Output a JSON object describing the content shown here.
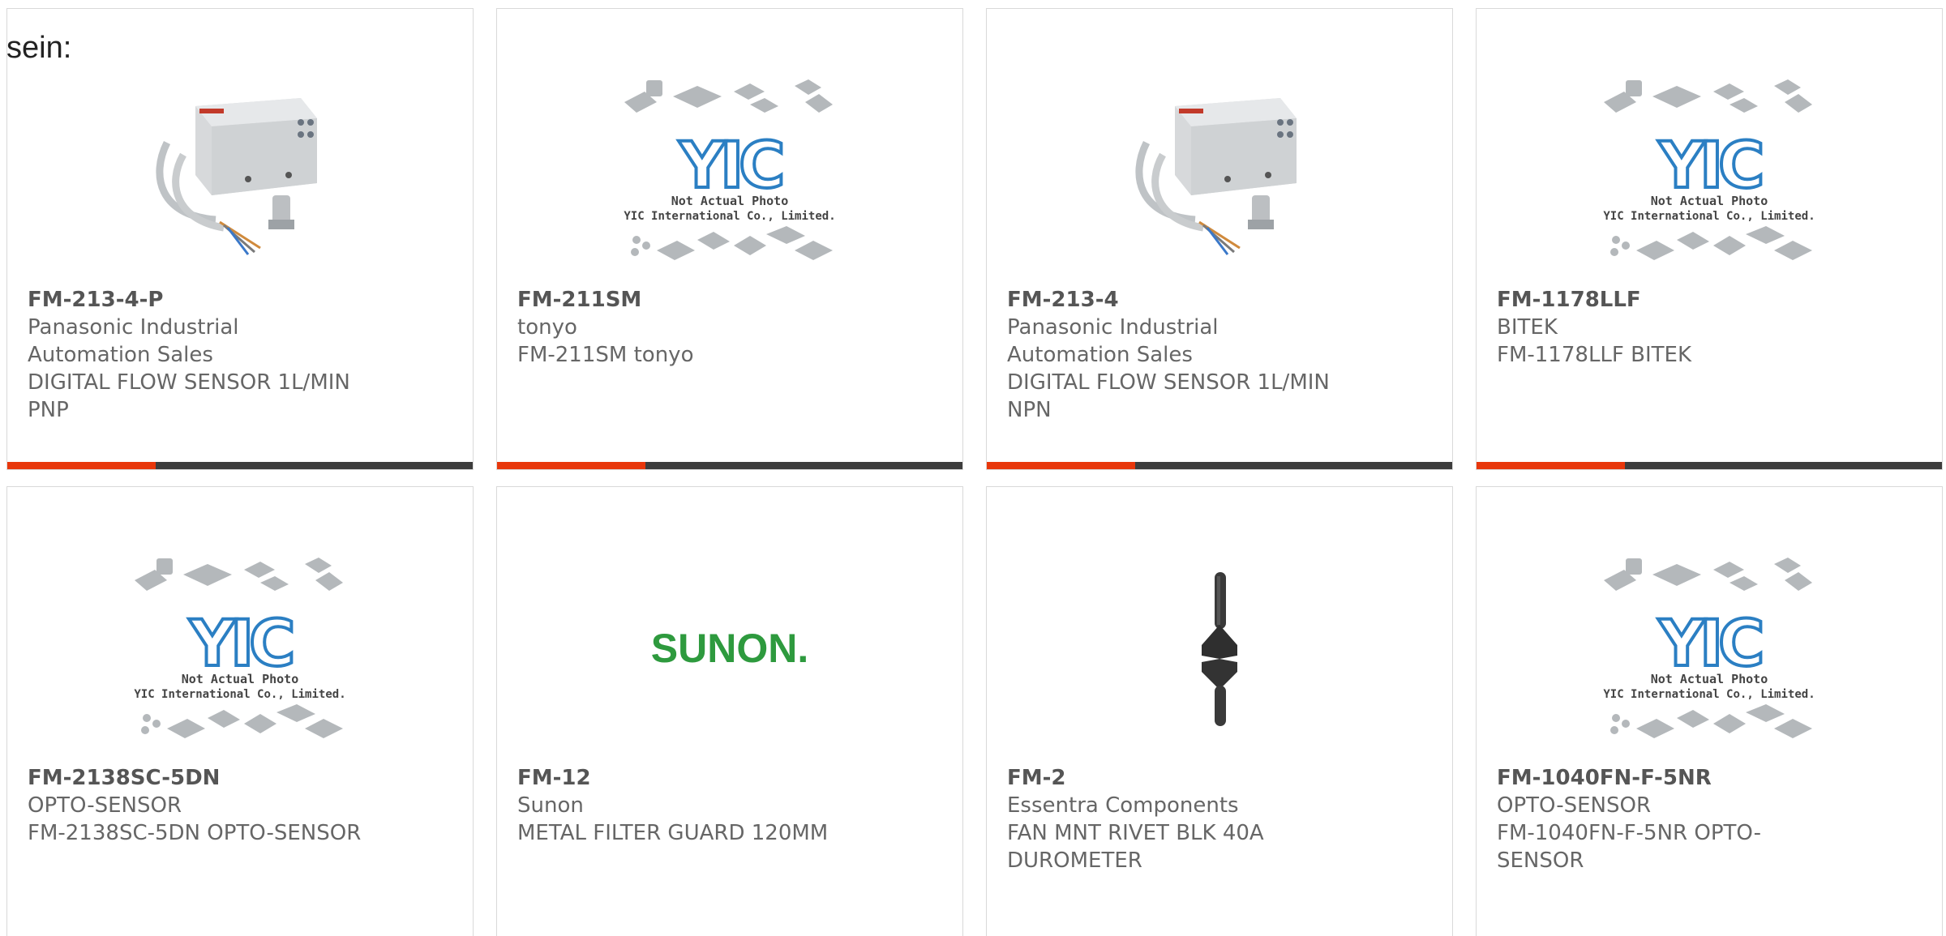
{
  "page": {
    "intro_text": "sein:"
  },
  "products": [
    {
      "part_number": "FM-213-4-P",
      "manufacturer": "Panasonic Industrial Automation Sales",
      "description": "DIGITAL FLOW SENSOR 1L/MIN PNP",
      "image": "flow-sensor-photo"
    },
    {
      "part_number": "FM-211SM",
      "manufacturer": "tonyo",
      "description": "FM-211SM tonyo",
      "image": "yic-placeholder",
      "placeholder_line1": "Not Actual Photo",
      "placeholder_line2": "YIC International Co., Limited."
    },
    {
      "part_number": "FM-213-4",
      "manufacturer": "Panasonic Industrial Automation Sales",
      "description": "DIGITAL FLOW SENSOR 1L/MIN NPN",
      "image": "flow-sensor-photo"
    },
    {
      "part_number": "FM-1178LLF",
      "manufacturer": "BITEK",
      "description": "FM-1178LLF BITEK",
      "image": "yic-placeholder",
      "placeholder_line1": "Not Actual Photo",
      "placeholder_line2": "YIC International Co., Limited."
    },
    {
      "part_number": "FM-2138SC-5DN",
      "manufacturer": "OPTO-SENSOR",
      "description": "FM-2138SC-5DN OPTO-SENSOR",
      "image": "yic-placeholder",
      "placeholder_line1": "Not Actual Photo",
      "placeholder_line2": "YIC International Co., Limited."
    },
    {
      "part_number": "FM-12",
      "manufacturer": "Sunon",
      "description": "METAL FILTER GUARD 120MM",
      "image": "sunon-logo",
      "logo_text": "SUNON."
    },
    {
      "part_number": "FM-2",
      "manufacturer": "Essentra Components",
      "description": "FAN MNT RIVET BLK 40A DUROMETER",
      "image": "fan-rivet-photo"
    },
    {
      "part_number": "FM-1040FN-F-5NR",
      "manufacturer": "OPTO-SENSOR",
      "description": "FM-1040FN-F-5NR OPTO-SENSOR",
      "image": "yic-placeholder",
      "placeholder_line1": "Not Actual Photo",
      "placeholder_line2": "YIC International Co., Limited."
    }
  ],
  "colors": {
    "accent": "#e8370c",
    "bar": "#3d3d3d",
    "yic_blue": "#2b7fc3",
    "sunon_green": "#2e9a3e"
  }
}
